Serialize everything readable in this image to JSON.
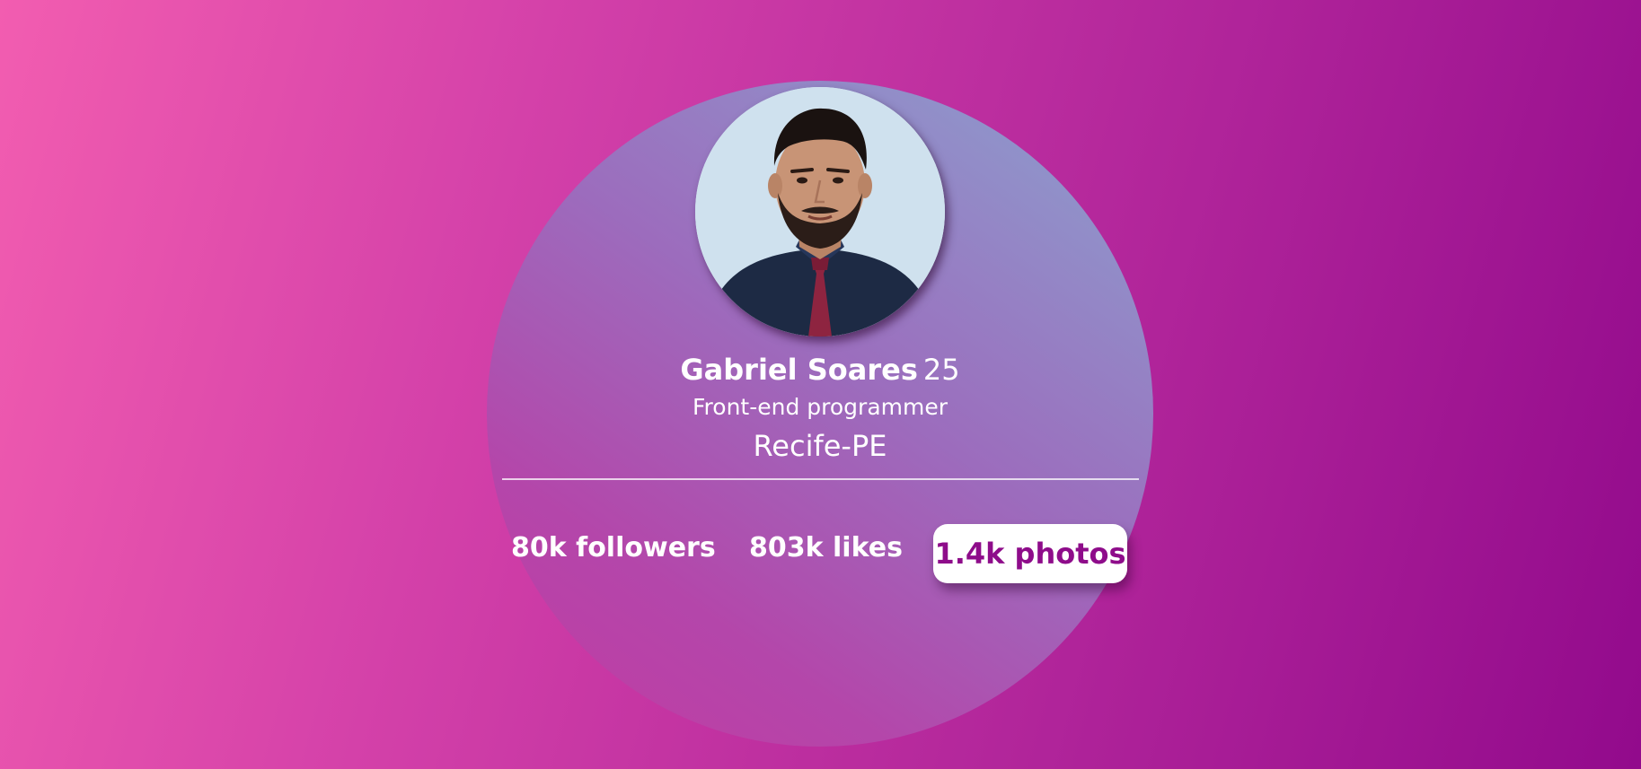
{
  "profile": {
    "name": "Gabriel Soares",
    "age": "25",
    "job": "Front-end programmer",
    "city": "Recife-PE",
    "avatar_alt": "Gabriel Soares profile photo"
  },
  "stats": {
    "followers": "80k followers",
    "likes": "803k likes",
    "photos": "1.4k photos"
  },
  "colors": {
    "background_start": "#f25db0",
    "background_end": "#920a8c",
    "accent": "#8e0c8a",
    "card_circle": "#9c6cbd"
  }
}
